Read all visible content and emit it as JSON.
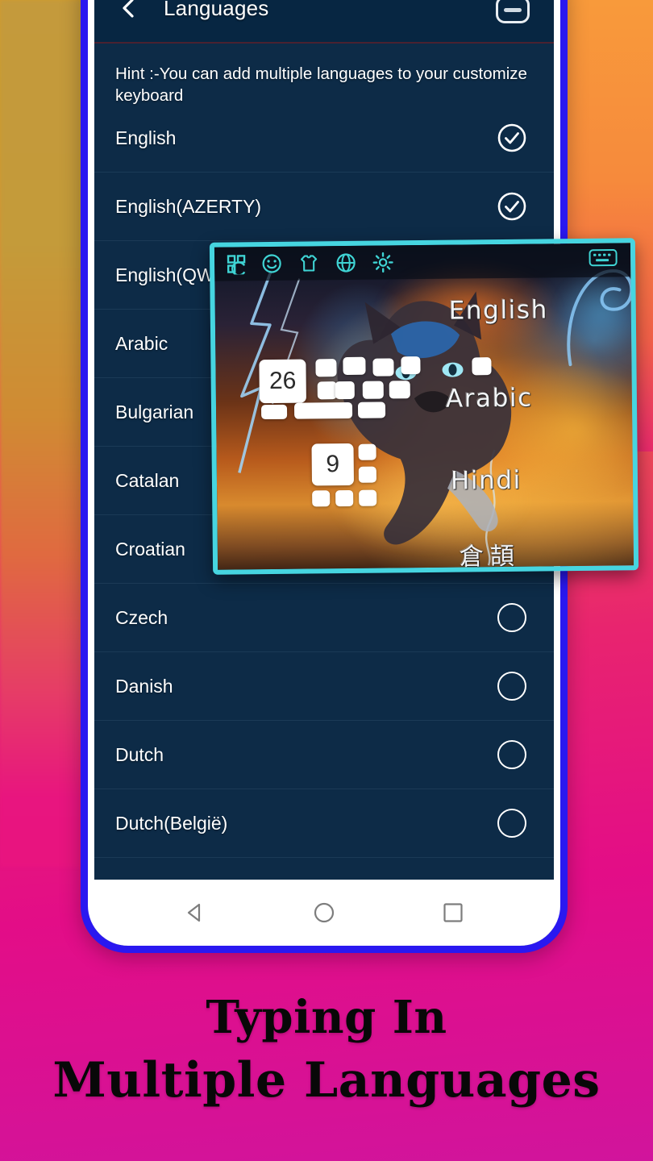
{
  "app": {
    "header": {
      "title": "Languages",
      "back_icon": "back-arrow-icon",
      "minimize_icon": "minimize-icon"
    },
    "hint": "Hint :-You can add multiple languages to your customize keyboard",
    "languages": [
      {
        "label": "English",
        "state": "checked"
      },
      {
        "label": "English(AZERTY)",
        "state": "checked"
      },
      {
        "label": "English(QWERTZ)",
        "state": "unchecked"
      },
      {
        "label": "Arabic",
        "state": "unchecked"
      },
      {
        "label": "Bulgarian",
        "state": "unchecked"
      },
      {
        "label": "Catalan",
        "state": "unchecked"
      },
      {
        "label": "Croatian",
        "state": "unchecked"
      },
      {
        "label": "Czech",
        "state": "unchecked"
      },
      {
        "label": "Danish",
        "state": "unchecked"
      },
      {
        "label": "Dutch",
        "state": "unchecked"
      },
      {
        "label": "Dutch(België)",
        "state": "unchecked"
      }
    ]
  },
  "keyboard_preview": {
    "toolbar_icons": [
      "apps-grid-icon",
      "emoji-icon",
      "tshirt-theme-icon",
      "globe-language-icon",
      "gear-settings-icon",
      "keyboard-icon"
    ],
    "layout_badges": [
      "26",
      "9"
    ],
    "language_labels": [
      "English",
      "Arabic",
      "Hindi",
      "倉頡"
    ],
    "theme_name": "flaming-wolf-theme"
  },
  "navbar": {
    "buttons": [
      "back-triangle-icon",
      "home-circle-icon",
      "recents-square-icon"
    ]
  },
  "caption": {
    "line1": "Typing In",
    "line2": "Multiple Languages"
  },
  "colors": {
    "phone_frame": "#2a18f0",
    "screen_bg": "#0d2b47",
    "header_bg": "#072642",
    "overlay_border": "#46d5e0",
    "bg_pink": "#e8157f",
    "bg_orange": "#f89a3b",
    "caption_text": "#080808"
  }
}
